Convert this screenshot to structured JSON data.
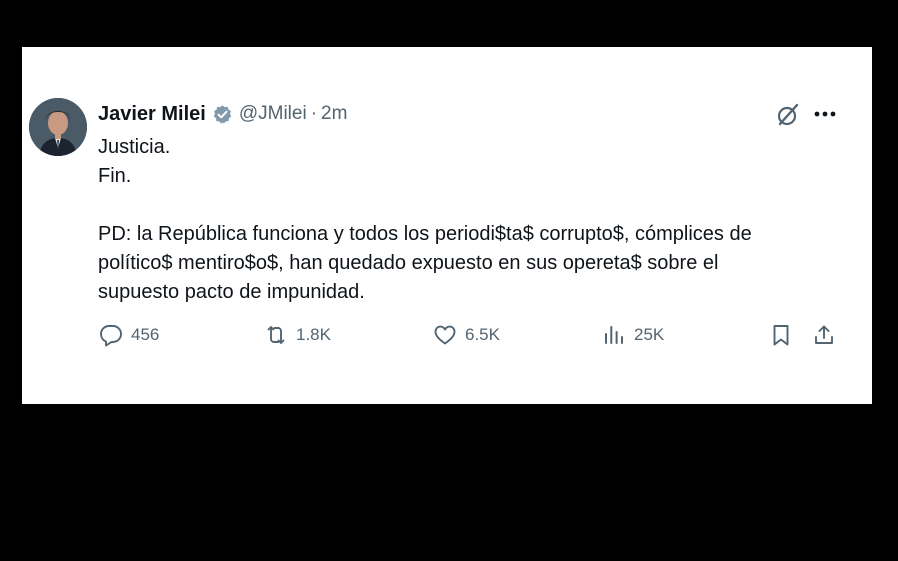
{
  "tweet": {
    "author_name": "Javier Milei",
    "handle": "@JMilei",
    "separator": "·",
    "time": "2m",
    "lines": [
      "Justicia.",
      "Fin.",
      "",
      "PD: la República funciona y todos los periodi$ta$ corrupto$, cómplices de",
      "político$ mentiro$o$, han quedado expuesto en sus opereta$ sobre el",
      "supuesto pacto de impunidad."
    ]
  },
  "actions": {
    "replies": "456",
    "reposts": "1.8K",
    "likes": "6.5K",
    "views": "25K"
  },
  "icons": {
    "verified": "verified-badge-icon",
    "grok": "grok-icon",
    "more": "more-icon",
    "reply": "reply-icon",
    "repost": "repost-icon",
    "like": "heart-icon",
    "views": "views-icon",
    "bookmark": "bookmark-icon",
    "share": "share-icon"
  },
  "colors": {
    "background": "#000000",
    "card": "#ffffff",
    "text": "#0f1419",
    "secondary": "#536471",
    "verified": "#829aab"
  }
}
